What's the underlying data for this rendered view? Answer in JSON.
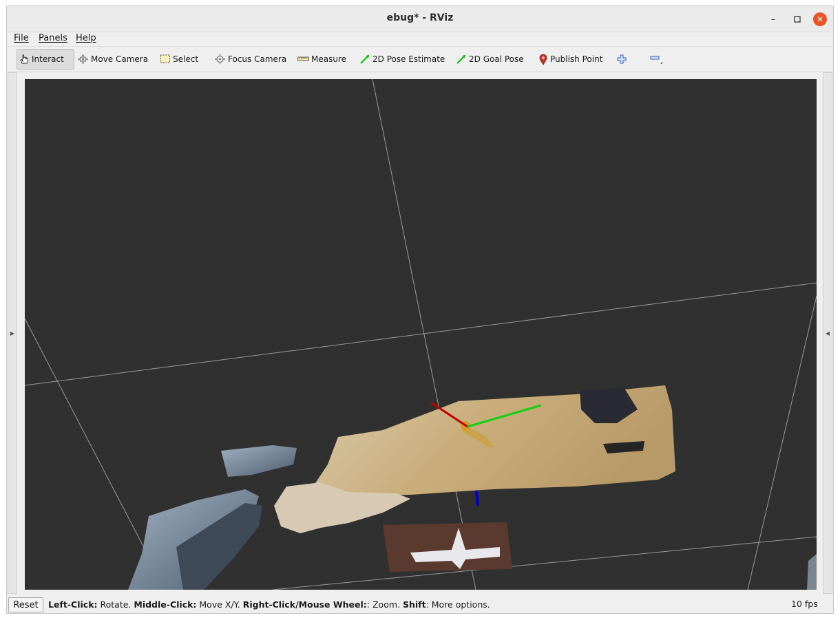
{
  "window": {
    "title": "ebug* - RViz",
    "controls": [
      "minimize",
      "maximize",
      "close"
    ]
  },
  "menubar": {
    "items": [
      {
        "label": "File"
      },
      {
        "label": "Panels"
      },
      {
        "label": "Help"
      }
    ]
  },
  "toolbar": {
    "tools": [
      {
        "label": "Interact",
        "icon": "hand-cursor-icon",
        "active": true
      },
      {
        "label": "Move Camera",
        "icon": "move-camera-icon"
      },
      {
        "label": "Select",
        "icon": "select-box-icon"
      },
      {
        "label": "Focus Camera",
        "icon": "focus-camera-icon"
      },
      {
        "label": "Measure",
        "icon": "ruler-icon"
      },
      {
        "label": "2D Pose Estimate",
        "icon": "green-arrow-icon"
      },
      {
        "label": "2D Goal Pose",
        "icon": "green-arrow-icon"
      },
      {
        "label": "Publish Point",
        "icon": "map-pin-icon"
      }
    ],
    "add_tool_icon": "plus-icon",
    "remove_tool_icon": "minus-icon"
  },
  "viewport": {
    "background": "#303030",
    "grid_color": "#a0a0a0",
    "axes": {
      "x": "#c00000",
      "y": "#10d010",
      "z": "#0000d0"
    }
  },
  "statusbar": {
    "reset_label": "Reset",
    "hint": [
      {
        "bold": "Left-Click:",
        "text": " Rotate. "
      },
      {
        "bold": "Middle-Click:",
        "text": " Move X/Y. "
      },
      {
        "bold": "Right-Click/Mouse Wheel:",
        "text": ": Zoom. "
      },
      {
        "bold": "Shift",
        "text": ": More options."
      }
    ],
    "fps": "10 fps"
  }
}
